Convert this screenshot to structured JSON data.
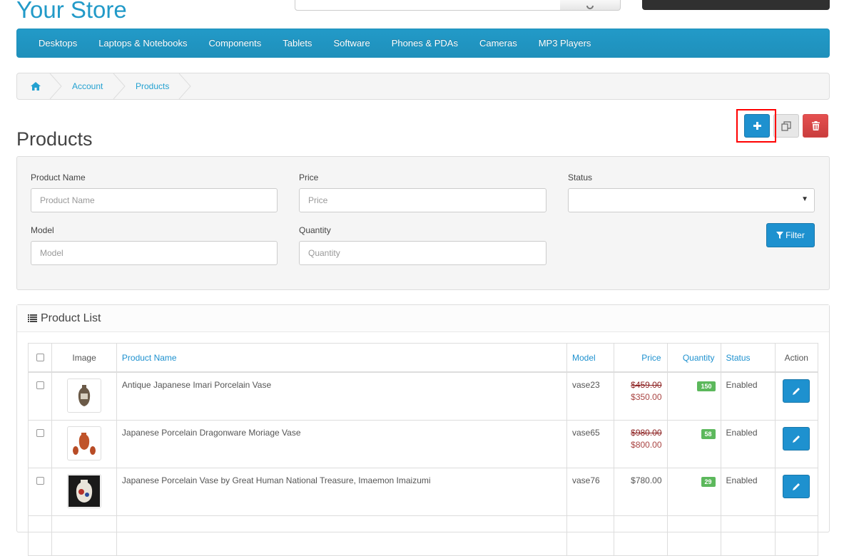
{
  "header": {
    "store_title": "Your Store"
  },
  "menu": {
    "items": [
      "Desktops",
      "Laptops & Notebooks",
      "Components",
      "Tablets",
      "Software",
      "Phones & PDAs",
      "Cameras",
      "MP3 Players"
    ]
  },
  "breadcrumb": {
    "home_icon": "home-icon",
    "items": [
      "Account",
      "Products"
    ]
  },
  "page": {
    "title": "Products",
    "buttons": {
      "add_icon": "plus-icon",
      "copy_icon": "copy-icon",
      "delete_icon": "trash-icon"
    }
  },
  "filter": {
    "product_name_label": "Product Name",
    "product_name_placeholder": "Product Name",
    "price_label": "Price",
    "price_placeholder": "Price",
    "status_label": "Status",
    "status_value": "",
    "model_label": "Model",
    "model_placeholder": "Model",
    "quantity_label": "Quantity",
    "quantity_placeholder": "Quantity",
    "filter_button": "Filter"
  },
  "product_list": {
    "title": "Product List",
    "columns": {
      "image": "Image",
      "name": "Product Name",
      "model": "Model",
      "price": "Price",
      "quantity": "Quantity",
      "status": "Status",
      "action": "Action"
    },
    "rows": [
      {
        "name": "Antique Japanese Imari Porcelain Vase",
        "model": "vase23",
        "old_price": "$459.00",
        "price": "$350.00",
        "quantity": "150",
        "status": "Enabled"
      },
      {
        "name": "Japanese Porcelain Dragonware Moriage Vase",
        "model": "vase65",
        "old_price": "$980.00",
        "price": "$800.00",
        "quantity": "58",
        "status": "Enabled"
      },
      {
        "name": "Japanese Porcelain Vase by Great Human National Treasure, Imaemon Imaizumi",
        "model": "vase76",
        "old_price": "",
        "price": "$780.00",
        "quantity": "29",
        "status": "Enabled"
      }
    ]
  },
  "colors": {
    "accent": "#229ac8",
    "button_primary": "#1e91cf",
    "button_danger": "#d64a4a",
    "badge_success": "#5cb85c",
    "sale_price": "#a94442",
    "highlight": "#ff0000"
  }
}
